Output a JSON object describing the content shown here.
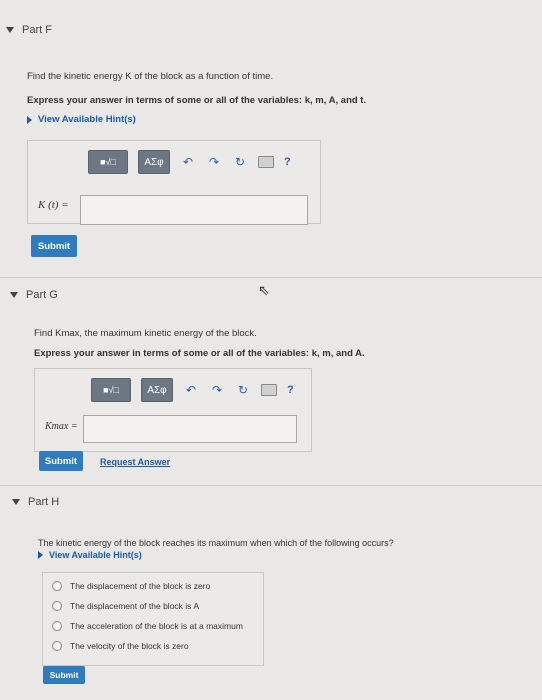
{
  "part_f": {
    "title": "Part F",
    "question": "Find the kinetic energy K of the block as a function of time.",
    "instruction": "Express your answer in terms of some or all of the variables: k, m, A, and t.",
    "hint_link": "View Available Hint(s)",
    "templates_label": "■√□",
    "greek_label": "ΑΣφ",
    "eq_label": "K (t) =",
    "input_value": "",
    "submit_label": "Submit"
  },
  "part_g": {
    "title": "Part G",
    "question": "Find Kmax, the maximum kinetic energy of the block.",
    "instruction": "Express your answer in terms of some or all of the variables: k, m, and A.",
    "templates_label": "■√□",
    "greek_label": "ΑΣφ",
    "eq_label": "Kmax =",
    "input_value": "",
    "submit_label": "Submit",
    "request_answer_label": "Request Answer"
  },
  "part_h": {
    "title": "Part H",
    "question": "The kinetic energy of the block reaches its maximum when which of the following occurs?",
    "hint_link": "View Available Hint(s)",
    "options": [
      "The displacement of the block is zero",
      "The displacement of the block is A",
      "The acceleration of the block is at a maximum",
      "The velocity of the block is zero"
    ],
    "submit_label": "Submit"
  },
  "icons": {
    "undo": "↶",
    "redo": "↷",
    "reset": "↻",
    "help": "?"
  }
}
